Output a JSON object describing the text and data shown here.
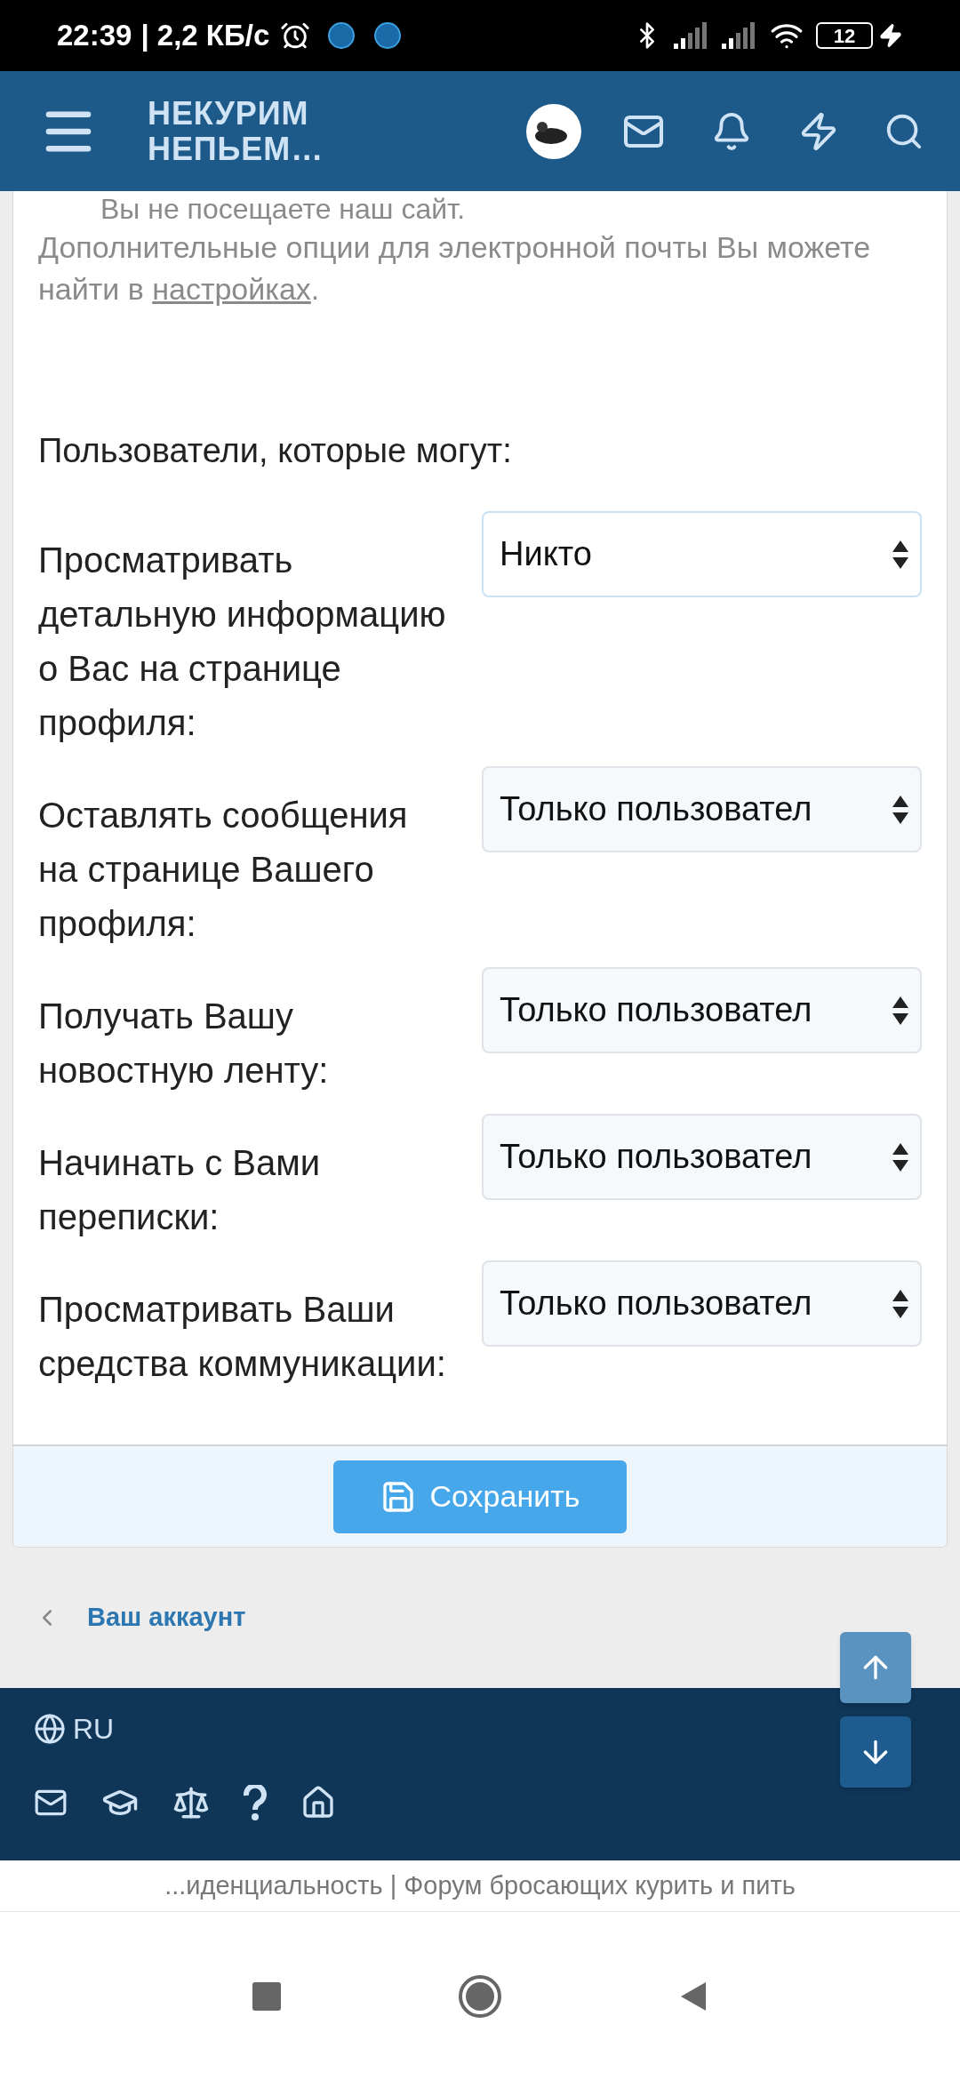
{
  "status_bar": {
    "time": "22:39",
    "speed": "| 2,2 КБ/с",
    "battery": "12"
  },
  "header": {
    "logo_lines": [
      "НЕКУРИМ",
      "НЕПЬЕМ…"
    ]
  },
  "intro": {
    "cut_line": "Вы не посещаете наш сайт.",
    "note": "Дополнительные опции для электронной почты Вы можете найти в ",
    "link": "настройках",
    "note_end": "."
  },
  "privacy": {
    "heading": "Пользователи, которые могут:",
    "rows": [
      {
        "label": "Просматривать детальную информацию о Вас на странице профиля:",
        "value": "Никто",
        "focused": true
      },
      {
        "label": "Оставлять сообщения на странице Вашего профиля:",
        "value": "Только пользовател",
        "focused": false
      },
      {
        "label": "Получать Вашу новостную ленту:",
        "value": "Только пользовател",
        "focused": false
      },
      {
        "label": "Начинать с Вами переписки:",
        "value": "Только пользовател",
        "focused": false
      },
      {
        "label": "Просматривать Ваши средства коммуникации:",
        "value": "Только пользовател",
        "focused": false
      }
    ]
  },
  "save_button": "Сохранить",
  "breadcrumb": "Ваш аккаунт",
  "footer": {
    "language": "RU"
  },
  "url_bar": "...иденциальность | Форум бросающих курить и пить"
}
